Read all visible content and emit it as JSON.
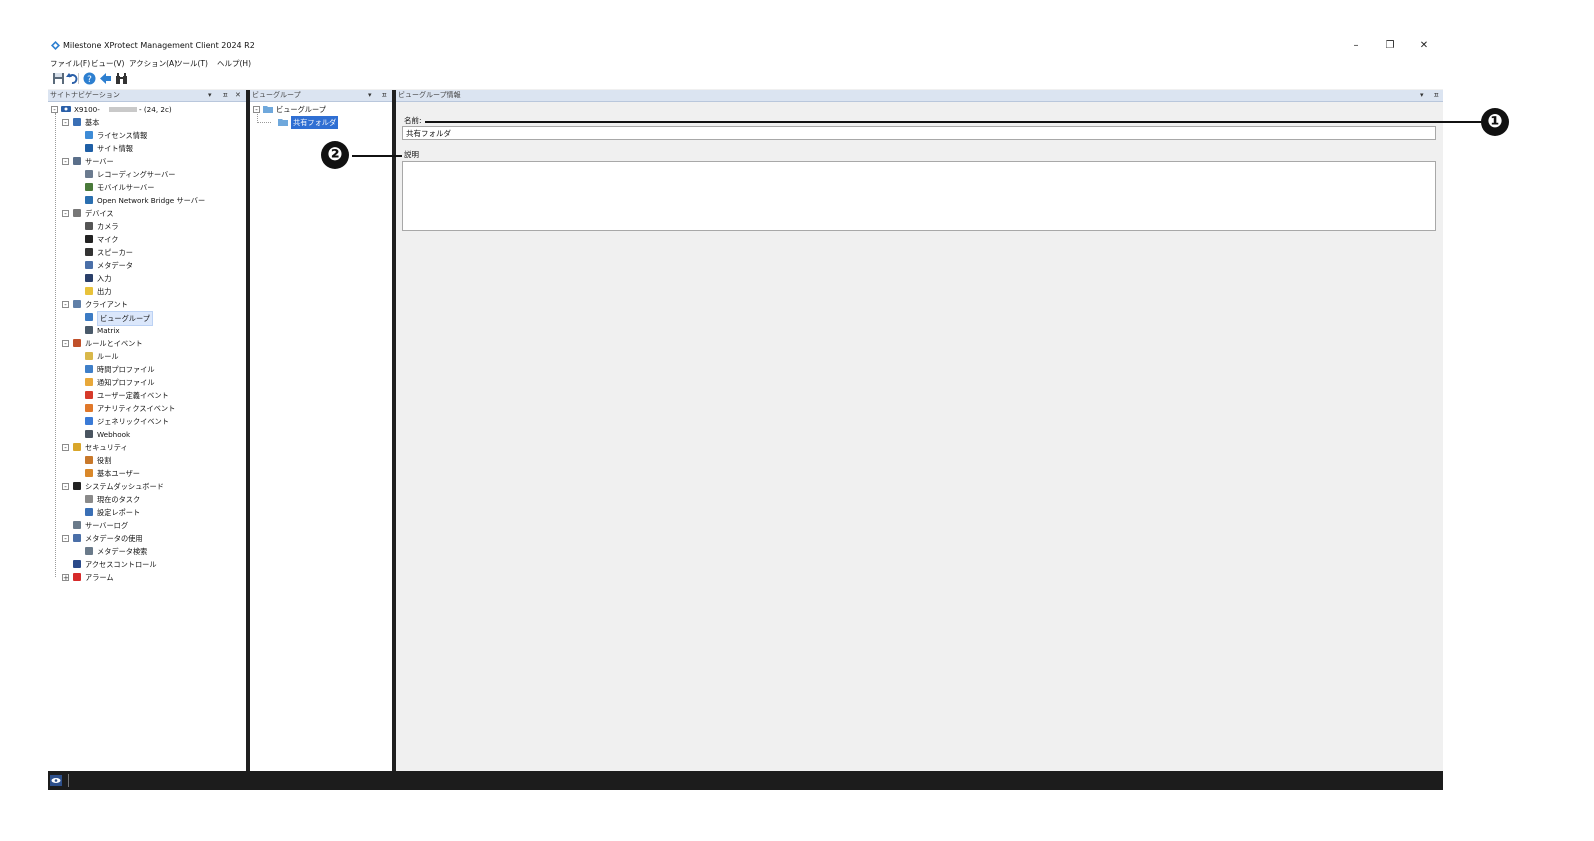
{
  "window": {
    "title": "Milestone XProtect Management Client 2024 R2",
    "controls": {
      "minimize": "–",
      "restore": "❐",
      "close": "✕"
    }
  },
  "menu": [
    "ファイル(F)",
    "ビュー(V)",
    "アクション(A)",
    "ツール(T)",
    "ヘルプ(H)"
  ],
  "toolbar": {
    "icons": [
      "save-icon",
      "undo-icon",
      "help-icon",
      "back-icon",
      "binoculars-icon"
    ]
  },
  "site_nav": {
    "header": "サイトナビゲーション",
    "ctrls": {
      "dropdown": "▾",
      "pin": "ㅍ",
      "close": "✕"
    },
    "root": {
      "name": "X9100-",
      "suffix": "- (24, 2c)"
    },
    "items": [
      {
        "label": "基本",
        "level": 1,
        "exp": "-",
        "icon": "#3a6fb5"
      },
      {
        "label": "ライセンス情報",
        "level": 2,
        "icon": "#3d8bd6"
      },
      {
        "label": "サイト情報",
        "level": 2,
        "icon": "#1f5fa6"
      },
      {
        "label": "サーバー",
        "level": 1,
        "exp": "-",
        "icon": "#5a6f8a"
      },
      {
        "label": "レコーディングサーバー",
        "level": 2,
        "icon": "#6b7b8f"
      },
      {
        "label": "モバイルサーバー",
        "level": 2,
        "icon": "#4a7a3a"
      },
      {
        "label": "Open Network Bridge サーバー",
        "level": 2,
        "icon": "#2a6fb0"
      },
      {
        "label": "デバイス",
        "level": 1,
        "exp": "-",
        "icon": "#777777"
      },
      {
        "label": "カメラ",
        "level": 2,
        "icon": "#555555"
      },
      {
        "label": "マイク",
        "level": 2,
        "icon": "#222222"
      },
      {
        "label": "スピーカー",
        "level": 2,
        "icon": "#333333"
      },
      {
        "label": "メタデータ",
        "level": 2,
        "icon": "#4a6fa8"
      },
      {
        "label": "入力",
        "level": 2,
        "icon": "#2a3f6a"
      },
      {
        "label": "出力",
        "level": 2,
        "icon": "#e8c23a"
      },
      {
        "label": "クライアント",
        "level": 1,
        "exp": "-",
        "icon": "#5f7fa8"
      },
      {
        "label": "ビューグループ",
        "level": 2,
        "icon": "#3b7bc4",
        "highlight": true
      },
      {
        "label": "Matrix",
        "level": 2,
        "icon": "#4a5a6a"
      },
      {
        "label": "ルールとイベント",
        "level": 1,
        "exp": "-",
        "icon": "#c0502a"
      },
      {
        "label": "ルール",
        "level": 2,
        "icon": "#d9b84a"
      },
      {
        "label": "時間プロファイル",
        "level": 2,
        "icon": "#3f7fc8"
      },
      {
        "label": "通知プロファイル",
        "level": 2,
        "icon": "#e8a83a"
      },
      {
        "label": "ユーザー定義イベント",
        "level": 2,
        "icon": "#d63a2a"
      },
      {
        "label": "アナリティクスイベント",
        "level": 2,
        "icon": "#e0782a"
      },
      {
        "label": "ジェネリックイベント",
        "level": 2,
        "icon": "#3a7ad6"
      },
      {
        "label": "Webhook",
        "level": 2,
        "icon": "#4a5560"
      },
      {
        "label": "セキュリティ",
        "level": 1,
        "exp": "-",
        "icon": "#d9a62a"
      },
      {
        "label": "役割",
        "level": 2,
        "icon": "#c8782a"
      },
      {
        "label": "基本ユーザー",
        "level": 2,
        "icon": "#d9882a"
      },
      {
        "label": "システムダッシュボード",
        "level": 1,
        "exp": "-",
        "icon": "#222222"
      },
      {
        "label": "現在のタスク",
        "level": 2,
        "icon": "#8a8a8a"
      },
      {
        "label": "設定レポート",
        "level": 2,
        "icon": "#3a6fb5"
      },
      {
        "label": "サーバーログ",
        "level": 1,
        "icon": "#6a7a8a"
      },
      {
        "label": "メタデータの使用",
        "level": 1,
        "exp": "-",
        "icon": "#4a6fa8"
      },
      {
        "label": "メタデータ検索",
        "level": 2,
        "icon": "#6a7a8a"
      },
      {
        "label": "アクセスコントロール",
        "level": 1,
        "icon": "#2a4a8a"
      },
      {
        "label": "アラーム",
        "level": 1,
        "exp": "+",
        "icon": "#d62a2a"
      }
    ]
  },
  "view_groups": {
    "header": "ビューグループ",
    "ctrls": {
      "dropdown": "▾",
      "pin": "ㅍ"
    },
    "root": "ビューグループ",
    "child": "共有フォルダ"
  },
  "detail": {
    "header": "ビューグループ情報",
    "ctrls": {
      "dropdown": "▾",
      "pin": "ㅍ"
    },
    "name_label": "名前:",
    "name_value": "共有フォルダ",
    "desc_label": "説明",
    "desc_value": ""
  },
  "callouts": [
    "❶",
    "❷"
  ]
}
